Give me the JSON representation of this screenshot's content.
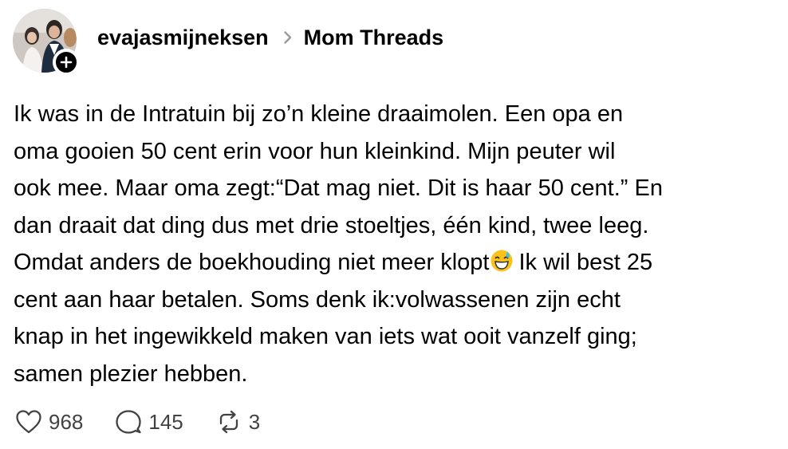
{
  "header": {
    "username": "evajasmijneksen",
    "separator_icon": "chevron-right-icon",
    "community": "Mom Threads",
    "avatar_badge_icon": "plus-icon"
  },
  "post": {
    "text_before_emoji": "Ik was in de Intratuin bij zo’n kleine draaimolen. Een opa en\noma gooien 50 cent erin voor hun kleinkind. Mijn peuter wil\nook mee. Maar oma zegt:“Dat mag niet. Dit is haar 50 cent.” En\ndan draait dat ding dus met drie stoeltjes, één kind, twee leeg.\nOmdat anders de boekhouding niet meer klopt",
    "emoji": "grinning-face-with-sweat-emoji",
    "text_after_emoji": "Ik wil best 25\ncent aan haar betalen. Soms denk ik:volwassenen zijn echt\nknap in het ingewikkeld maken van iets wat ooit vanzelf ging;\nsamen plezier hebben."
  },
  "actions": {
    "likes": "968",
    "replies": "145",
    "reposts": "3",
    "like_icon": "heart-icon",
    "reply_icon": "comment-icon",
    "repost_icon": "repost-icon"
  },
  "colors": {
    "text": "#000000",
    "secondary": "#424242",
    "chevron": "#999999"
  }
}
